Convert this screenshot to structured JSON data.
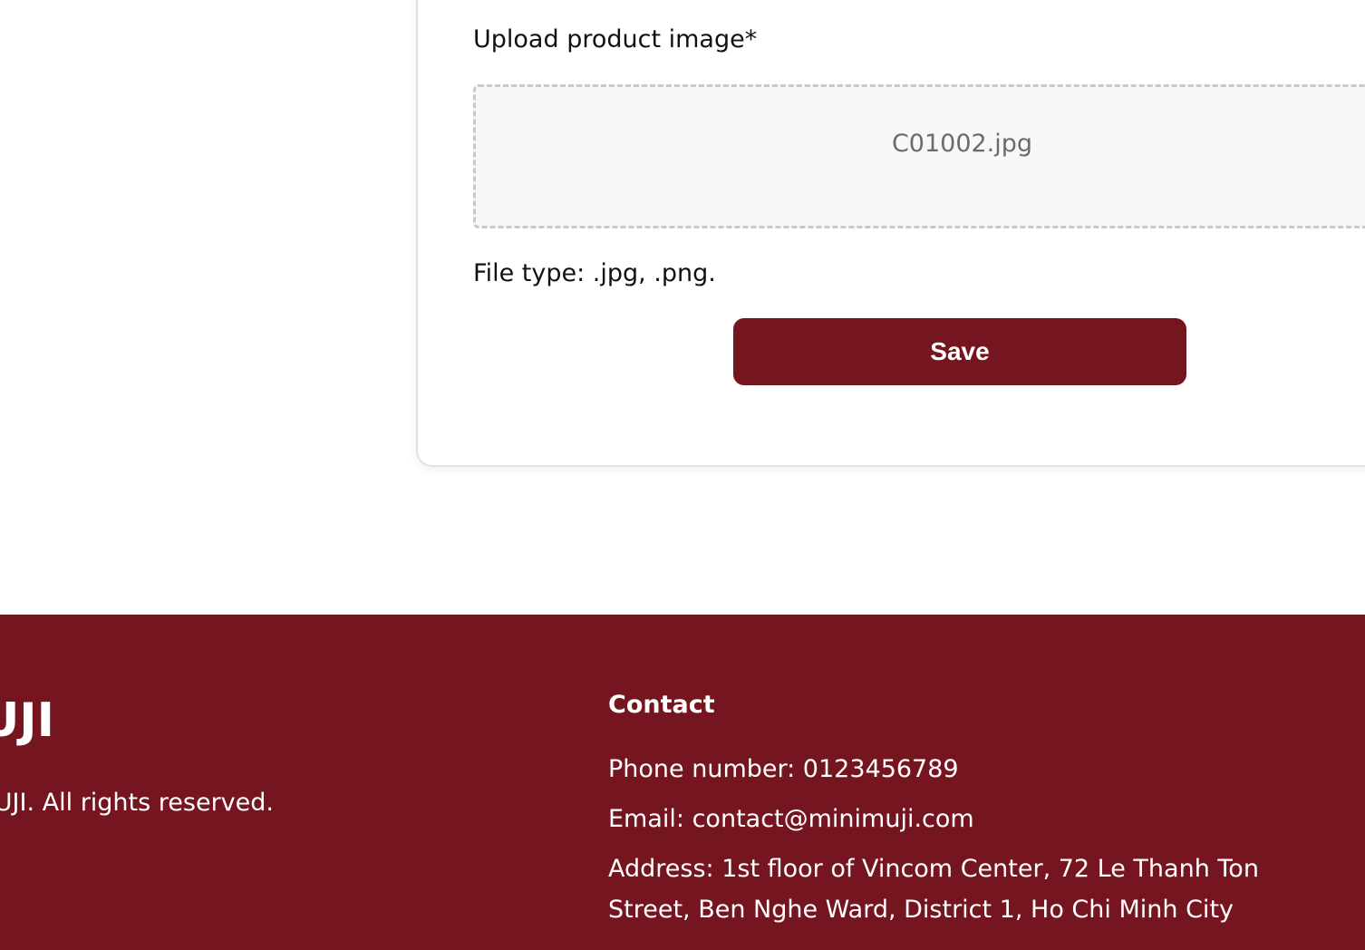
{
  "upload": {
    "label": "Upload product image*",
    "file_name": "C01002.jpg",
    "file_type_hint": "File type: .jpg, .png."
  },
  "actions": {
    "save_label": "Save"
  },
  "footer": {
    "logo_text": "UJI",
    "copyright": "UJI. All rights reserved.",
    "contact": {
      "title": "Contact",
      "phone": "Phone number: 0123456789",
      "email": "Email: contact@minimuji.com",
      "address_line1": "Address: 1st floor of Vincom Center, 72 Le Thanh Ton",
      "address_line2": "Street, Ben Nghe Ward, District 1, Ho Chi Minh City"
    }
  },
  "colors": {
    "brand": "#75151f",
    "dropzone_bg": "#f8f8f8",
    "dropzone_border": "#c9c9c9",
    "muted_text": "#6b6b6b"
  }
}
